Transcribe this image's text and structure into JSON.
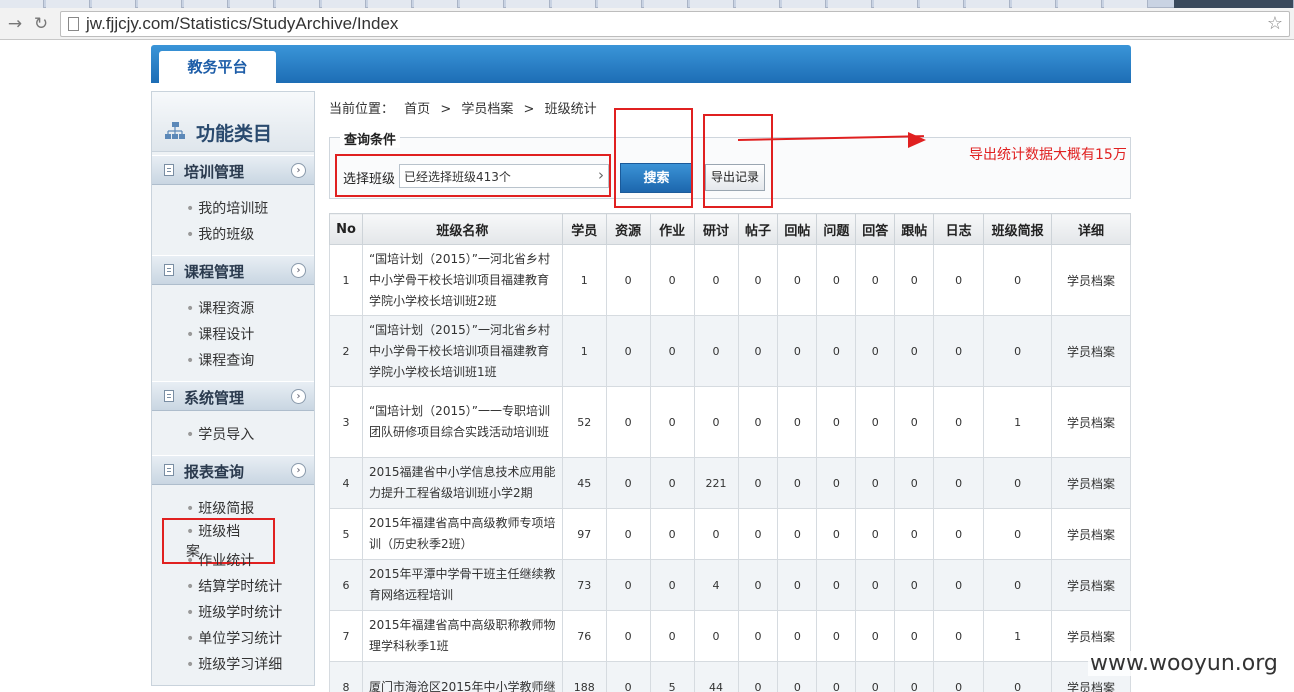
{
  "browser": {
    "url": "jw.fjjcjy.com/Statistics/StudyArchive/Index"
  },
  "header": {
    "platform_tab": "教务平台"
  },
  "sidebar": {
    "title": "功能类目",
    "groups": [
      {
        "label": "培训管理",
        "items": [
          "我的培训班",
          "我的班级"
        ]
      },
      {
        "label": "课程管理",
        "items": [
          "课程资源",
          "课程设计",
          "课程查询"
        ]
      },
      {
        "label": "系统管理",
        "items": [
          "学员导入"
        ]
      },
      {
        "label": "报表查询",
        "items": [
          "班级简报",
          "班级档案",
          "作业统计",
          "结算学时统计",
          "班级学时统计",
          "单位学习统计",
          "班级学习详细"
        ]
      }
    ]
  },
  "breadcrumb": {
    "prefix": "当前位置：",
    "items": [
      "首页",
      "学员档案",
      "班级统计"
    ],
    "separator": ">"
  },
  "query": {
    "legend": "查询条件",
    "select_label": "选择班级",
    "select_value": "已经选择班级413个",
    "search_button": "搜索",
    "export_button": "导出记录"
  },
  "annotation": {
    "text": "导出统计数据大概有15万"
  },
  "table": {
    "headers": [
      "No",
      "班级名称",
      "学员",
      "资源",
      "作业",
      "研讨",
      "帖子",
      "回帖",
      "问题",
      "回答",
      "跟帖",
      "日志",
      "班级简报",
      "详细"
    ],
    "rows": [
      {
        "no": "1",
        "name": "“国培计划（2015）”一河北省乡村中小学骨干校长培训项目福建教育学院小学校长培训班2班",
        "vals": [
          "1",
          "0",
          "0",
          "0",
          "0",
          "0",
          "0",
          "0",
          "0",
          "0",
          "0"
        ],
        "detail": "学员档案"
      },
      {
        "no": "2",
        "name": "“国培计划（2015）”一河北省乡村中小学骨干校长培训项目福建教育学院小学校长培训班1班",
        "vals": [
          "1",
          "0",
          "0",
          "0",
          "0",
          "0",
          "0",
          "0",
          "0",
          "0",
          "0"
        ],
        "detail": "学员档案"
      },
      {
        "no": "3",
        "name": "“国培计划（2015）”一一专职培训团队研修项目综合实践活动培训班",
        "vals": [
          "52",
          "0",
          "0",
          "0",
          "0",
          "0",
          "0",
          "0",
          "0",
          "0",
          "1"
        ],
        "detail": "学员档案"
      },
      {
        "no": "4",
        "name": "2015福建省中小学信息技术应用能力提升工程省级培训班小学2期",
        "vals": [
          "45",
          "0",
          "0",
          "221",
          "0",
          "0",
          "0",
          "0",
          "0",
          "0",
          "0"
        ],
        "detail": "学员档案"
      },
      {
        "no": "5",
        "name": "2015年福建省高中高级教师专项培训（历史秋季2班）",
        "vals": [
          "97",
          "0",
          "0",
          "0",
          "0",
          "0",
          "0",
          "0",
          "0",
          "0",
          "0"
        ],
        "detail": "学员档案"
      },
      {
        "no": "6",
        "name": "2015年平潭中学骨干班主任继续教育网络远程培训",
        "vals": [
          "73",
          "0",
          "0",
          "4",
          "0",
          "0",
          "0",
          "0",
          "0",
          "0",
          "0"
        ],
        "detail": "学员档案"
      },
      {
        "no": "7",
        "name": "2015年福建省高中高级职称教师物理学科秋季1班",
        "vals": [
          "76",
          "0",
          "0",
          "0",
          "0",
          "0",
          "0",
          "0",
          "0",
          "0",
          "1"
        ],
        "detail": "学员档案"
      },
      {
        "no": "8",
        "name": "厦门市海沧区2015年中小学教师继",
        "vals": [
          "188",
          "0",
          "5",
          "44",
          "0",
          "0",
          "0",
          "0",
          "0",
          "0",
          "0"
        ],
        "detail": "学员档案"
      }
    ]
  },
  "watermark": "www.wooyun.org"
}
